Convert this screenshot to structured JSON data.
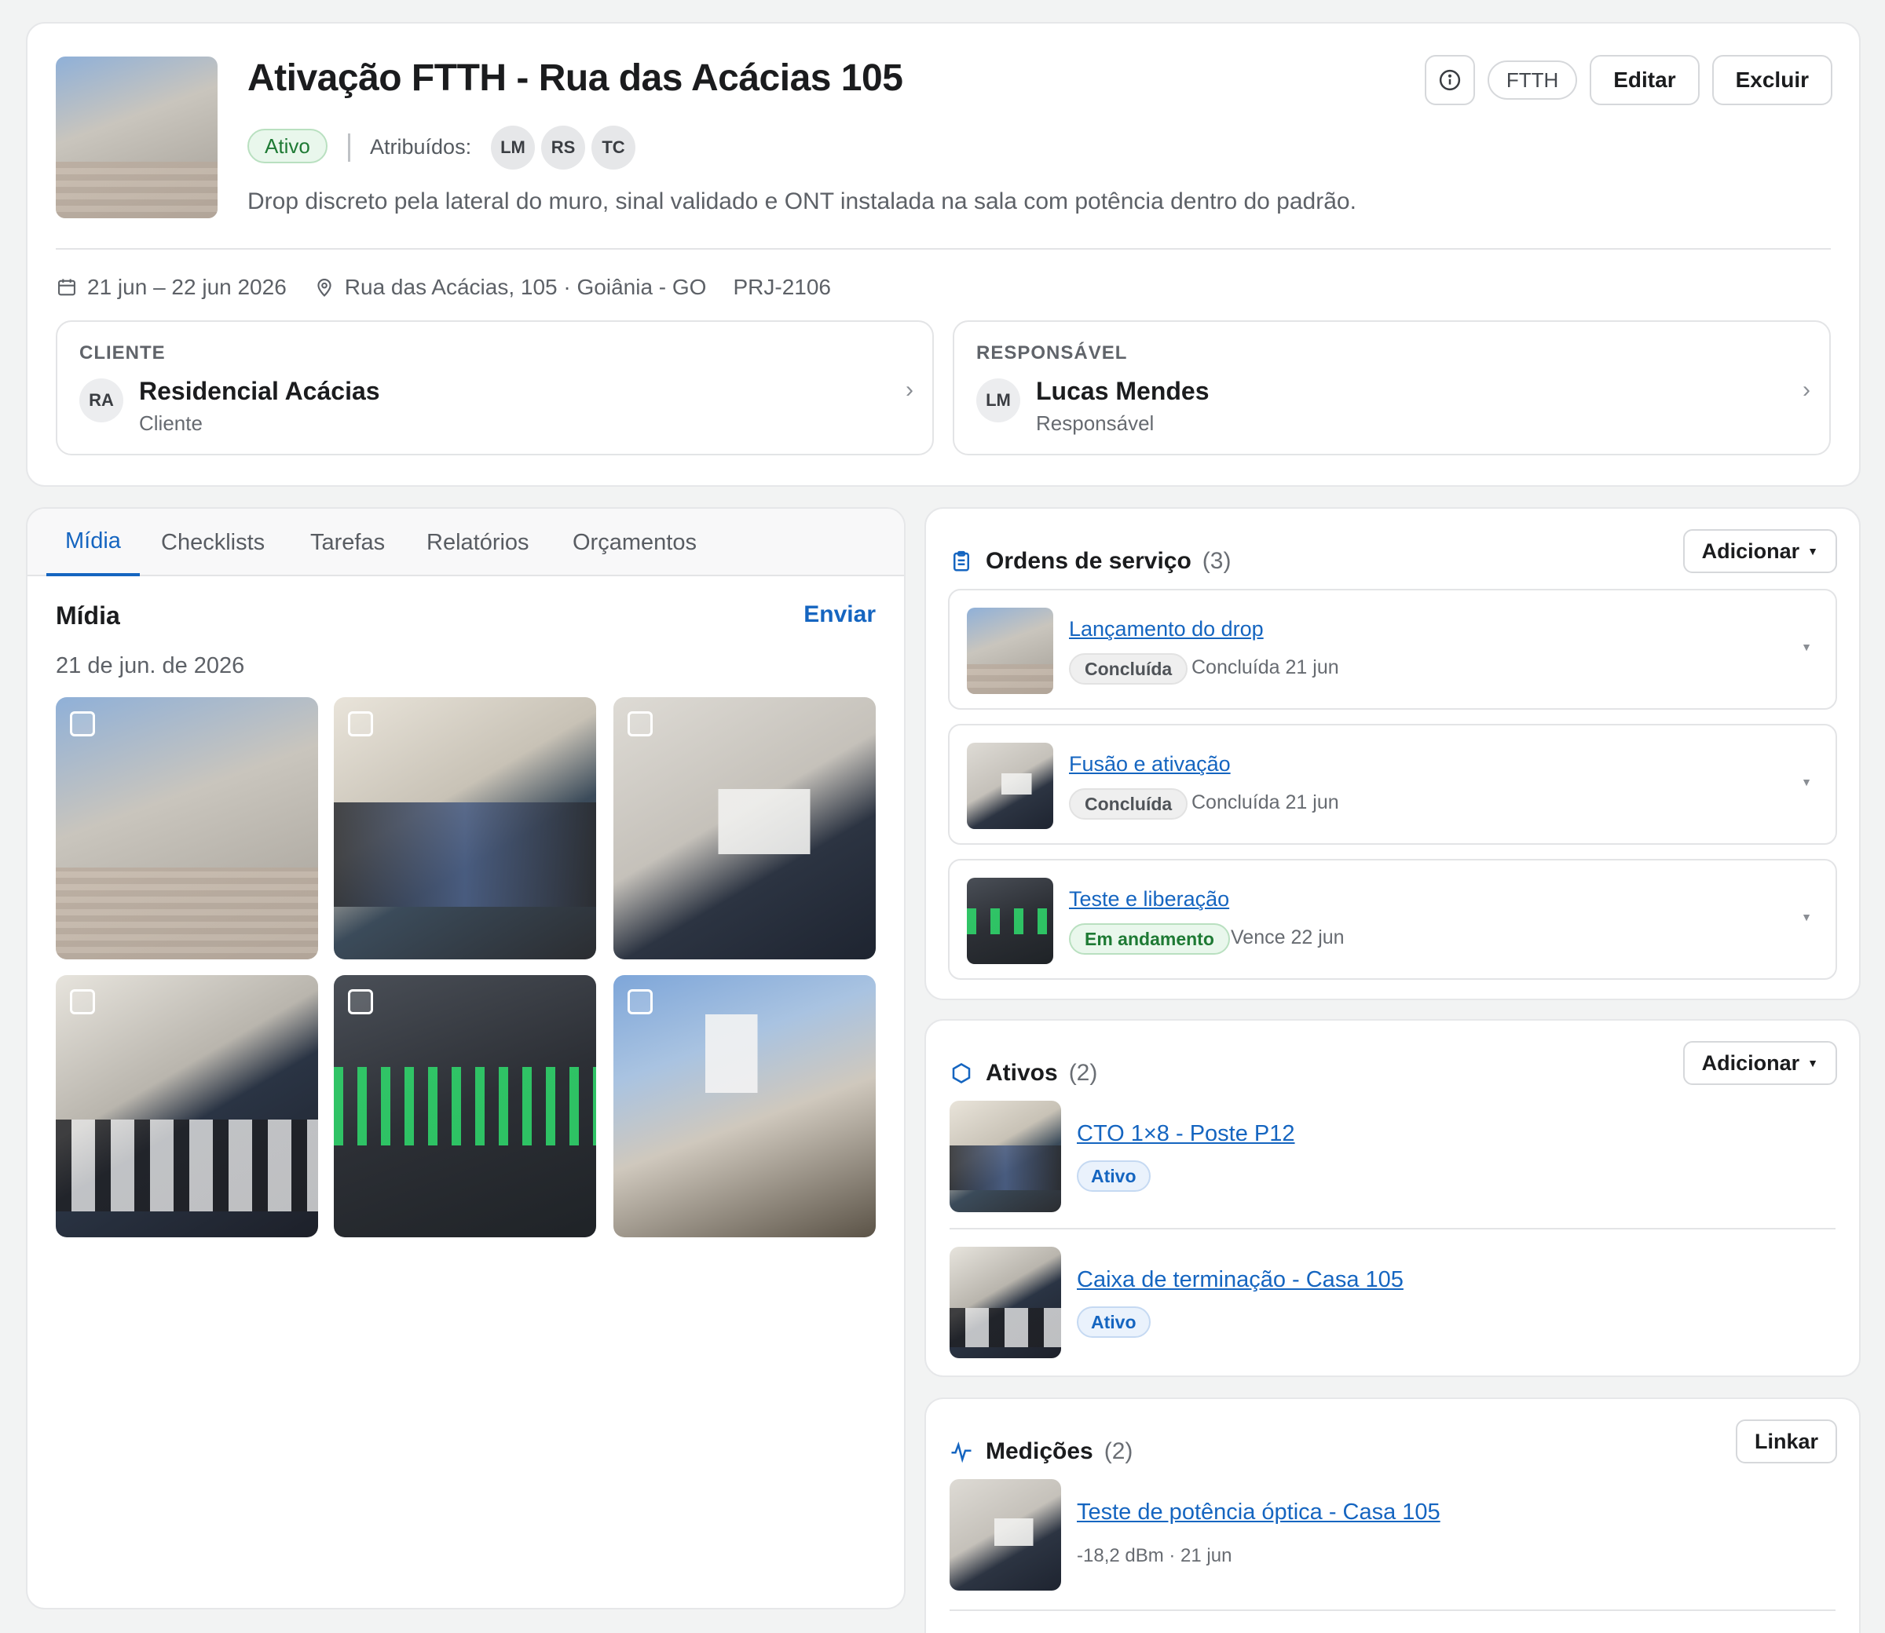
{
  "header": {
    "title": "Ativação FTTH - Rua das Acácias 105",
    "status": "Ativo",
    "assigned_label": "Atribuídos:",
    "assignees": [
      "LM",
      "RS",
      "TC"
    ],
    "description": "Drop discreto pela lateral do muro, sinal validado e ONT instalada na sala com potência dentro do padrão.",
    "tag": "FTTH",
    "edit_label": "Editar",
    "delete_label": "Excluir",
    "date_range": "21 jun – 22 jun 2026",
    "address": "Rua das Acácias, 105 · Goiânia - GO",
    "project_code": "PRJ-2106"
  },
  "client": {
    "label": "CLIENTE",
    "initials": "RA",
    "name": "Residencial Acácias",
    "role": "Cliente"
  },
  "responsible": {
    "label": "RESPONSÁVEL",
    "initials": "LM",
    "name": "Lucas Mendes",
    "role": "Responsável"
  },
  "tabs": [
    {
      "label": "Mídia",
      "active": true
    },
    {
      "label": "Checklists",
      "active": false
    },
    {
      "label": "Tarefas",
      "active": false
    },
    {
      "label": "Relatórios",
      "active": false
    },
    {
      "label": "Orçamentos",
      "active": false
    }
  ],
  "media": {
    "title": "Mídia",
    "send_label": "Enviar",
    "date_group": "21 de jun. de 2026"
  },
  "orders": {
    "title": "Ordens de serviço",
    "count": "(3)",
    "add_label": "Adicionar",
    "items": [
      {
        "title": "Lançamento do drop",
        "status": "Concluída",
        "meta": "Concluída 21 jun"
      },
      {
        "title": "Fusão e ativação",
        "status": "Concluída",
        "meta": "Concluída 21 jun"
      },
      {
        "title": "Teste e liberação",
        "status": "Em andamento",
        "meta": "Vence 22 jun"
      }
    ]
  },
  "assets": {
    "title": "Ativos",
    "count": "(2)",
    "add_label": "Adicionar",
    "items": [
      {
        "title": "CTO 1×8 - Poste P12",
        "status": "Ativo"
      },
      {
        "title": "Caixa de terminação - Casa 105",
        "status": "Ativo"
      }
    ]
  },
  "measurements": {
    "title": "Medições",
    "count": "(2)",
    "link_label": "Linkar",
    "items": [
      {
        "title": "Teste de potência óptica - Casa 105",
        "meta": "-18,2 dBm · 21 jun"
      }
    ]
  },
  "colors": {
    "accent": "#1565c0",
    "success": "#1e7a34",
    "success_bg": "#e9f7ec"
  }
}
